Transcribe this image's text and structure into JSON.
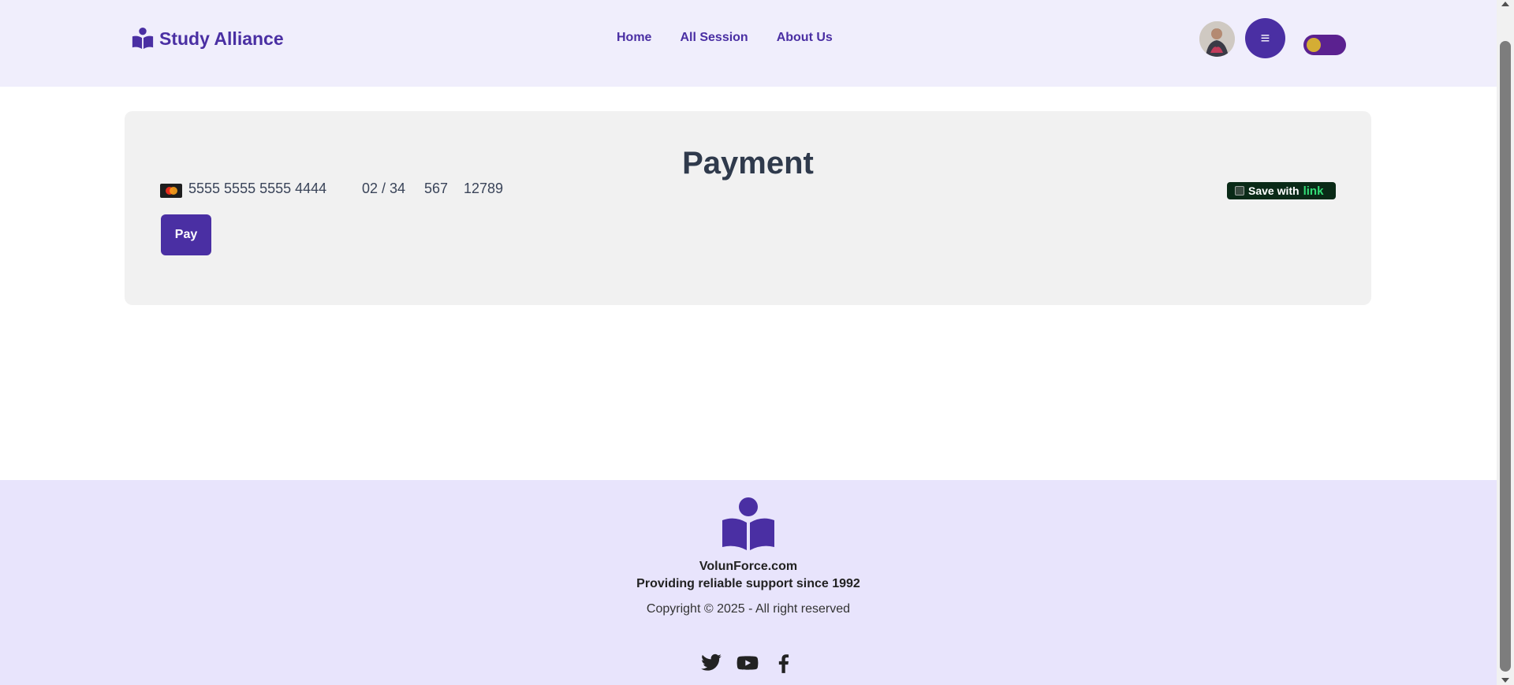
{
  "header": {
    "brand": "Study Alliance",
    "nav": [
      "Home",
      "All Session",
      "About Us"
    ]
  },
  "payment": {
    "title": "Payment",
    "card_number": "5555 5555 5555 4444",
    "expiry": "02 / 34",
    "cvc": "567",
    "zip": "12789",
    "save_with": "Save with",
    "save_accent": "link",
    "pay_label": "Pay"
  },
  "footer": {
    "site": "VolunForce.com",
    "tagline": "Providing reliable support since 1992",
    "copyright": "Copyright © 2025 - All right reserved"
  },
  "colors": {
    "brand": "#4a2fa3",
    "header_bg": "#f0eefc",
    "footer_bg": "#e8e4fc",
    "toggle_bg": "#5b2190",
    "toggle_knob": "#d4ad34"
  },
  "icons": [
    "book-reader-icon",
    "hamburger-menu-icon",
    "mastercard-icon",
    "twitter-icon",
    "youtube-icon",
    "facebook-icon"
  ]
}
